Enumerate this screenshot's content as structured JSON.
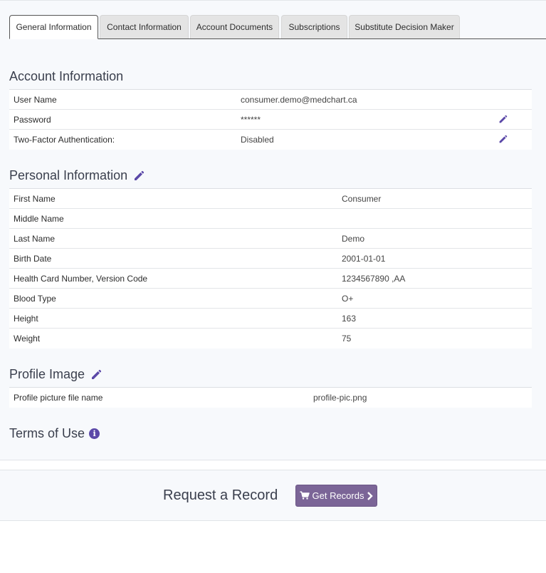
{
  "tabs": [
    {
      "label": "General Information",
      "active": true
    },
    {
      "label": "Contact Information",
      "active": false
    },
    {
      "label": "Account Documents",
      "active": false
    },
    {
      "label": "Subscriptions",
      "active": false
    },
    {
      "label": "Substitute Decision Maker",
      "active": false
    }
  ],
  "account": {
    "title": "Account Information",
    "rows": [
      {
        "label": "User Name",
        "value": "consumer.demo@medchart.ca"
      },
      {
        "label": "Password",
        "value": "******"
      },
      {
        "label": "Two-Factor Authentication:",
        "value": "Disabled"
      }
    ]
  },
  "personal": {
    "title": "Personal Information",
    "rows": [
      {
        "label": "First Name",
        "value": "Consumer"
      },
      {
        "label": "Middle Name",
        "value": ""
      },
      {
        "label": "Last Name",
        "value": "Demo"
      },
      {
        "label": "Birth Date",
        "value": "2001-01-01"
      },
      {
        "label": "Health Card Number, Version Code",
        "value": "1234567890 ,AA"
      },
      {
        "label": "Blood Type",
        "value": "O+"
      },
      {
        "label": "Height",
        "value": "163"
      },
      {
        "label": "Weight",
        "value": "75"
      }
    ]
  },
  "profile_image": {
    "title": "Profile Image",
    "rows": [
      {
        "label": "Profile picture file name",
        "value": "profile-pic.png"
      }
    ]
  },
  "terms": {
    "title": "Terms of Use"
  },
  "request": {
    "title": "Request a Record",
    "button_label": "Get Records"
  },
  "icons": {
    "edit": "pencil-icon",
    "info": "info-circle-icon",
    "cart": "shopping-cart-icon",
    "chevron": "chevron-right-icon"
  },
  "colors": {
    "accent": "#5b48a8",
    "button": "#7b6597",
    "panel_bg": "#f7f9fc"
  }
}
